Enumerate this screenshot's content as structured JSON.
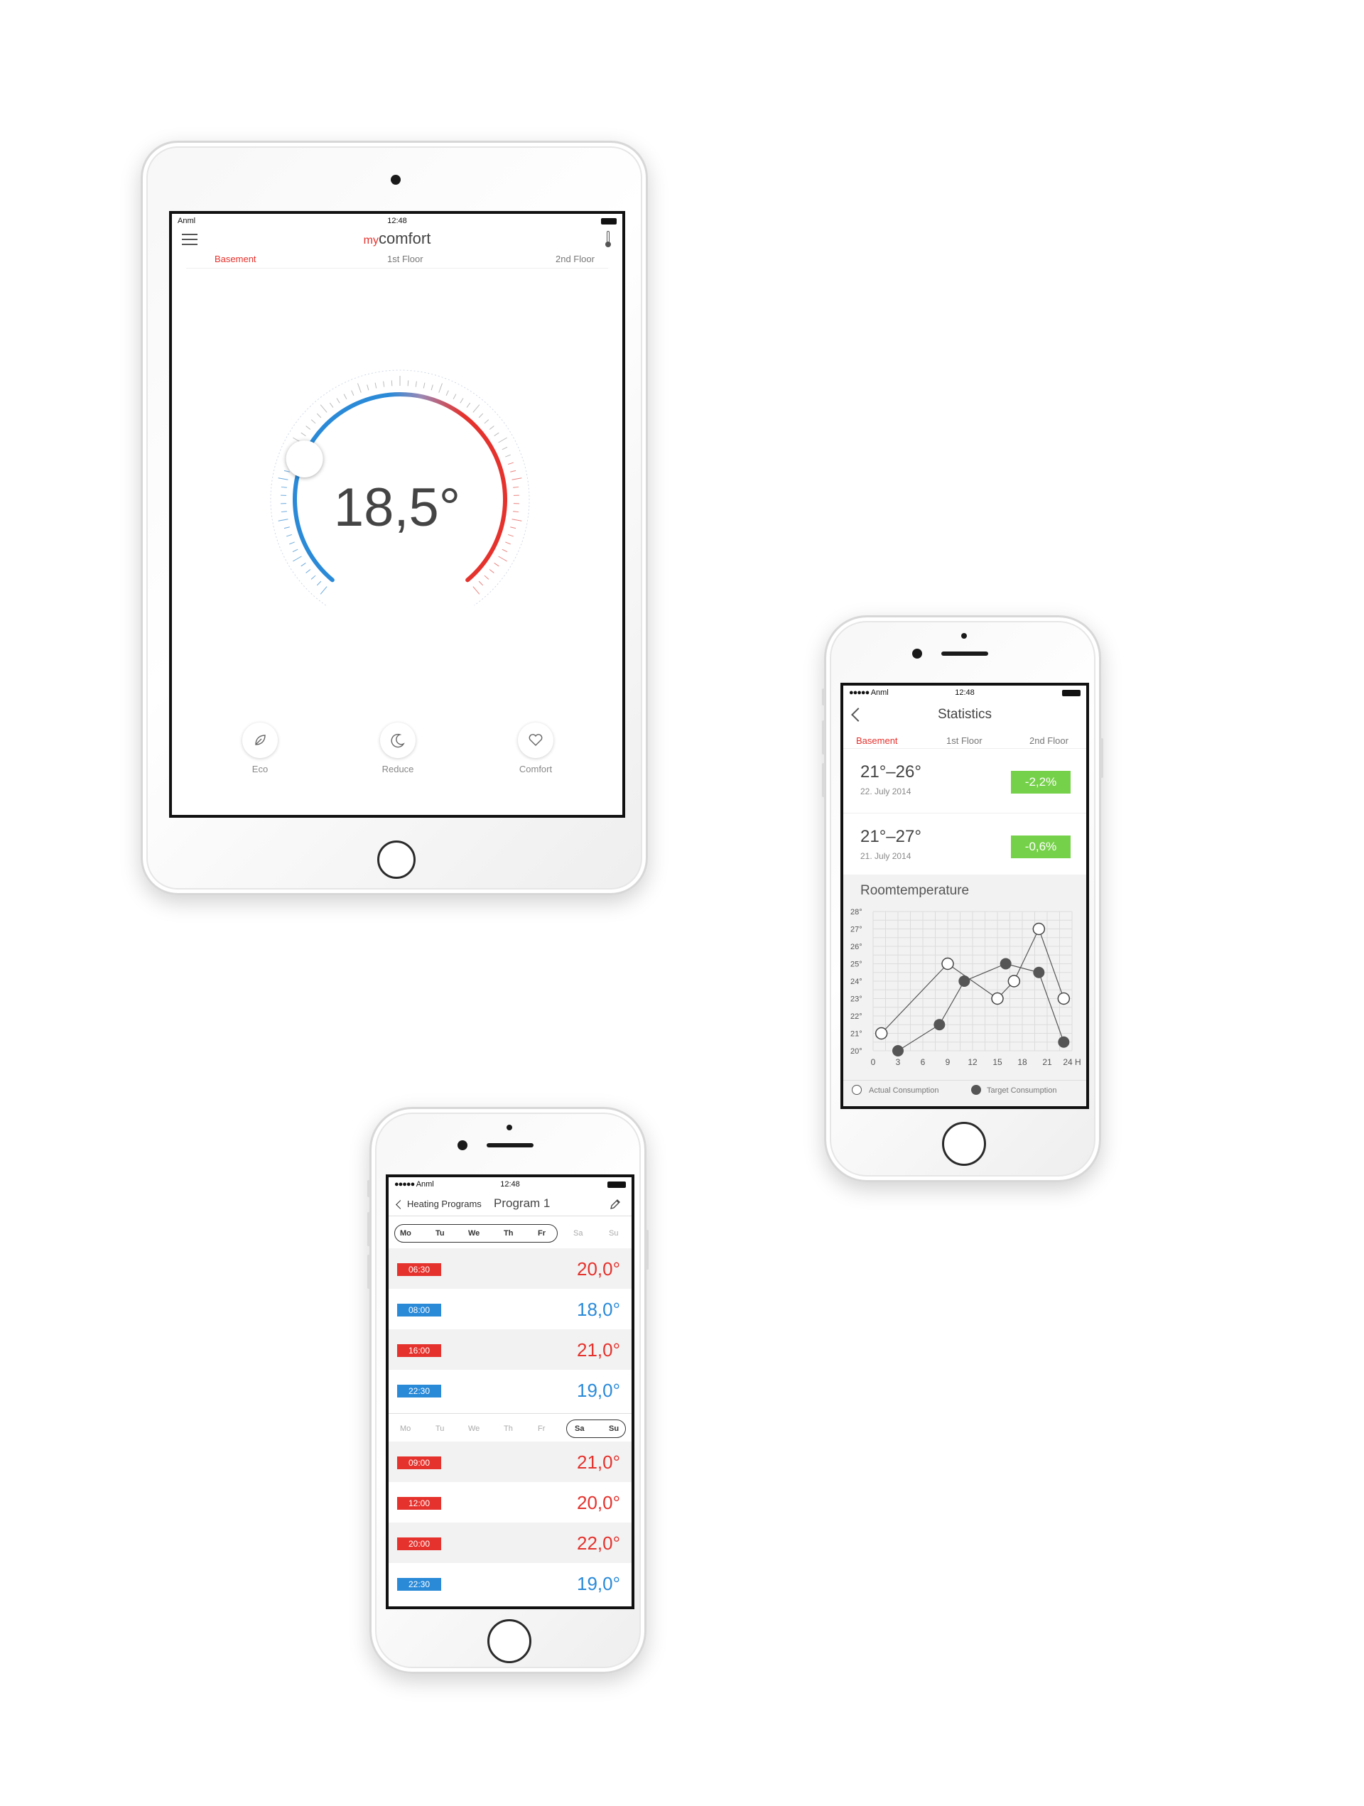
{
  "status_bar": {
    "carrier": "Anml",
    "time": "12:48"
  },
  "floors": [
    "Basement",
    "1st Floor",
    "2nd Floor"
  ],
  "tablet": {
    "logo_prefix": "my",
    "logo_main": "comfort",
    "temperature": "18,5°",
    "modes": [
      {
        "label": "Eco",
        "icon": "leaf-icon"
      },
      {
        "label": "Reduce",
        "icon": "moon-icon"
      },
      {
        "label": "Comfort",
        "icon": "heart-icon"
      }
    ]
  },
  "statistics": {
    "title": "Statistics",
    "entries": [
      {
        "range": "21°–26°",
        "date": "22. July 2014",
        "change": "-2,2%"
      },
      {
        "range": "21°–27°",
        "date": "21. July 2014",
        "change": "-0,6%"
      }
    ],
    "chart_title": "Roomtemperature",
    "legend_actual": "Actual Consumption",
    "legend_target": "Target Consumption",
    "chart_data": {
      "type": "line",
      "title": "Roomtemperature",
      "x_ticks": [
        "0",
        "3",
        "6",
        "9",
        "12",
        "15",
        "18",
        "21",
        "24 H"
      ],
      "y_ticks": [
        "20°",
        "21°",
        "22°",
        "23°",
        "24°",
        "25°",
        "26°",
        "27°",
        "28°"
      ],
      "xlim": [
        0,
        24
      ],
      "ylim": [
        20,
        28
      ],
      "grid": true,
      "legend": "bottom",
      "series": [
        {
          "name": "Actual Consumption",
          "marker": "open",
          "x": [
            1,
            9,
            15,
            17,
            20,
            23
          ],
          "y": [
            21,
            25,
            23,
            24,
            27,
            23
          ]
        },
        {
          "name": "Target Consumption",
          "marker": "filled",
          "x": [
            3,
            8,
            11,
            16,
            20,
            23
          ],
          "y": [
            20,
            21.5,
            24,
            25,
            24.5,
            20.5
          ]
        }
      ]
    }
  },
  "program": {
    "back_label": "Heating Programs",
    "title": "Program 1",
    "weekdays": [
      "Mo",
      "Tu",
      "We",
      "Th",
      "Fr",
      "Sa",
      "Su"
    ],
    "group1": [
      {
        "time": "06:30",
        "temp": "20,0°",
        "kind": "red"
      },
      {
        "time": "08:00",
        "temp": "18,0°",
        "kind": "blue"
      },
      {
        "time": "16:00",
        "temp": "21,0°",
        "kind": "red"
      },
      {
        "time": "22:30",
        "temp": "19,0°",
        "kind": "blue"
      }
    ],
    "group2": [
      {
        "time": "09:00",
        "temp": "21,0°",
        "kind": "red"
      },
      {
        "time": "12:00",
        "temp": "20,0°",
        "kind": "red"
      },
      {
        "time": "20:00",
        "temp": "22,0°",
        "kind": "red"
      },
      {
        "time": "22:30",
        "temp": "19,0°",
        "kind": "blue"
      }
    ]
  },
  "colors": {
    "red": "#e5322d",
    "blue": "#2a8ad8",
    "green": "#76d14a"
  }
}
